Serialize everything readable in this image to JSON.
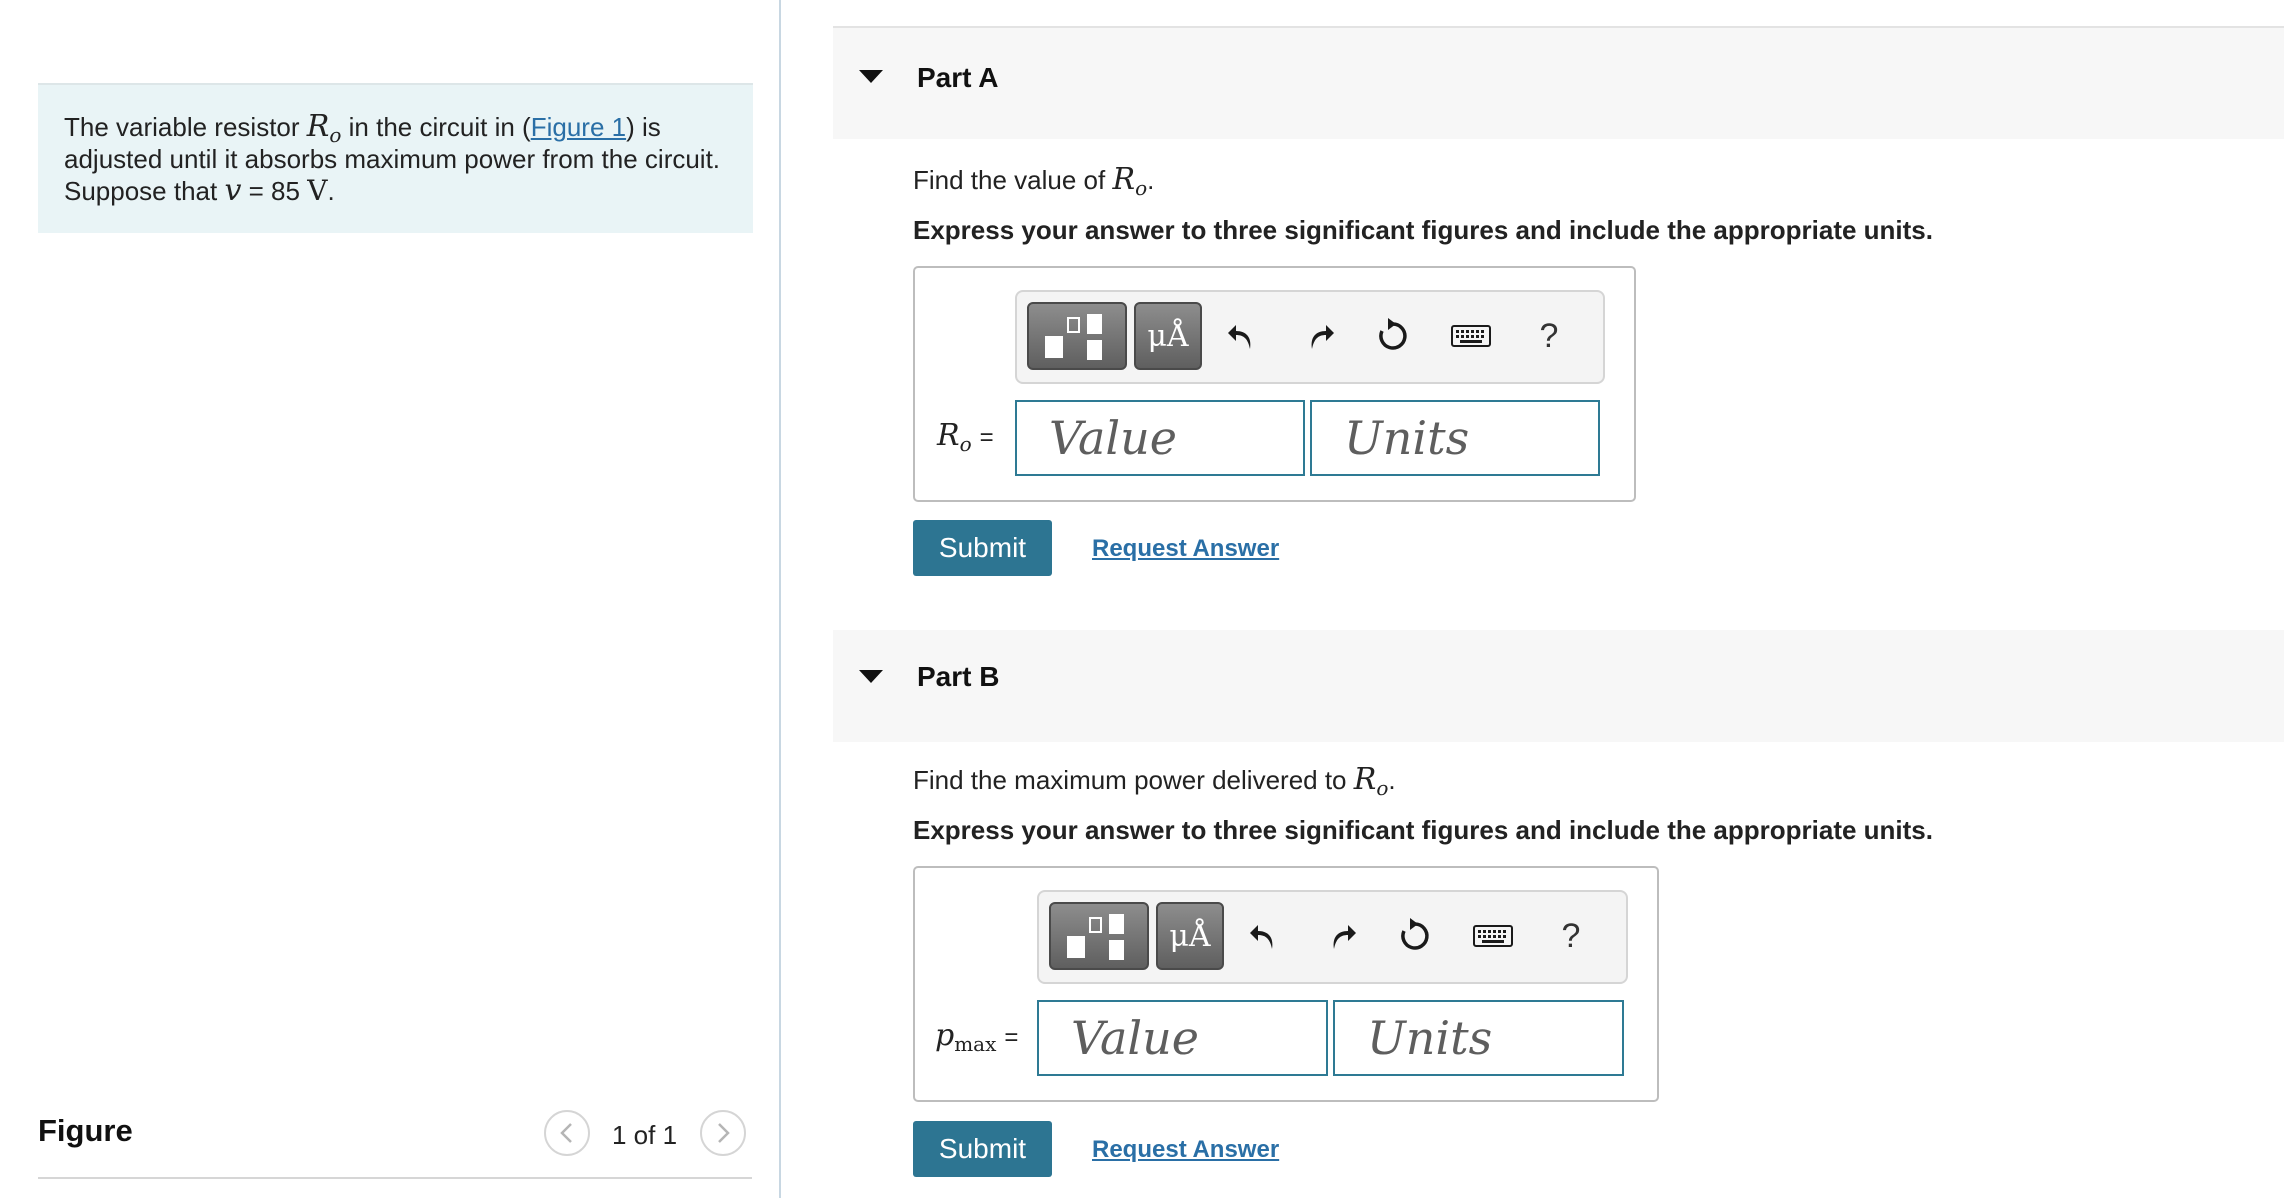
{
  "problem": {
    "intro": "The variable resistor ",
    "resistor_symbol": "R",
    "resistor_sub": "o",
    "text_mid": " in the circuit in (",
    "figure_link": "Figure 1",
    "text_line2": ") is adjusted until it absorbs maximum power from the circuit. Suppose that ",
    "v_symbol": "v",
    "v_eq": " = 85 ",
    "v_unit": "V",
    "end": "."
  },
  "figure": {
    "title": "Figure",
    "pager": "1 of 1",
    "prev_icon": "chevron-left-icon",
    "next_icon": "chevron-right-icon"
  },
  "parts": [
    {
      "title": "Part A",
      "question_prefix": "Find the value of ",
      "question_symbol": "R",
      "question_sub": "o",
      "question_suffix": ".",
      "instruction": "Express your answer to three significant figures and include the appropriate units.",
      "var_symbol": "R",
      "var_sub": "o",
      "eq": "=",
      "value_placeholder": "Value",
      "units_placeholder": "Units",
      "submit": "Submit",
      "request": "Request Answer"
    },
    {
      "title": "Part B",
      "question_prefix": "Find the maximum power delivered to ",
      "question_symbol": "R",
      "question_sub": "o",
      "question_suffix": ".",
      "instruction": "Express your answer to three significant figures and include the appropriate units.",
      "var_symbol": "p",
      "var_sub": "max",
      "eq": "=",
      "value_placeholder": "Value",
      "units_placeholder": "Units",
      "submit": "Submit",
      "request": "Request Answer"
    }
  ],
  "toolbar": {
    "units_label": "μÅ",
    "help_label": "?",
    "icons": [
      "templates-icon",
      "units-icon",
      "undo-icon",
      "redo-icon",
      "reset-icon",
      "keyboard-icon",
      "help-icon"
    ]
  },
  "colors": {
    "accent": "#2d7592",
    "link": "#2a6fa6",
    "problem_bg": "#e9f4f6",
    "field_border": "#2e7a94"
  }
}
